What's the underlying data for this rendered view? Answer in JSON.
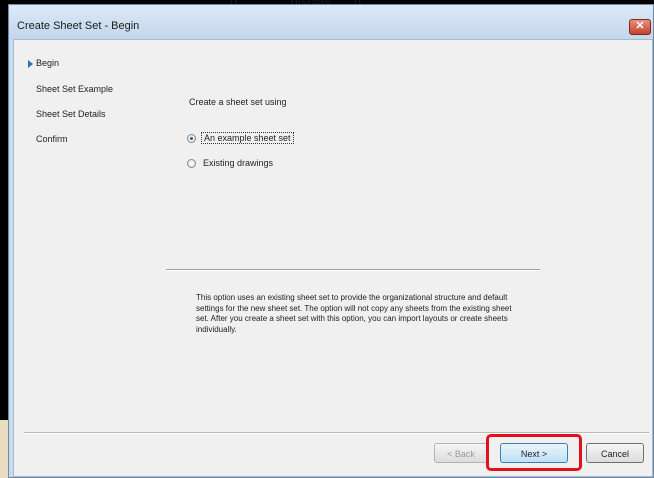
{
  "window": {
    "title": "Create Sheet Set - Begin",
    "close_glyph": "✕"
  },
  "background": {
    "behind_title_text": "g … … … dispiay, … g"
  },
  "nav": {
    "items": [
      {
        "label": "Begin",
        "current": true
      },
      {
        "label": "Sheet Set Example",
        "current": false
      },
      {
        "label": "Sheet Set Details",
        "current": false
      },
      {
        "label": "Confirm",
        "current": false
      }
    ]
  },
  "main": {
    "prompt": "Create a sheet set using",
    "options": [
      {
        "label": "An example sheet set",
        "checked": true
      },
      {
        "label": "Existing drawings",
        "checked": false
      }
    ],
    "description": "This option uses an existing sheet set to provide the organizational structure and default settings for the new sheet set.  The option will not copy any sheets from the existing sheet set.  After you create a sheet set with this option, you can import layouts or create sheets individually."
  },
  "buttons": {
    "back": "< Back",
    "next": "Next >",
    "cancel": "Cancel"
  },
  "colors": {
    "highlight": "#e3111a",
    "accent": "#2f6fb2"
  }
}
